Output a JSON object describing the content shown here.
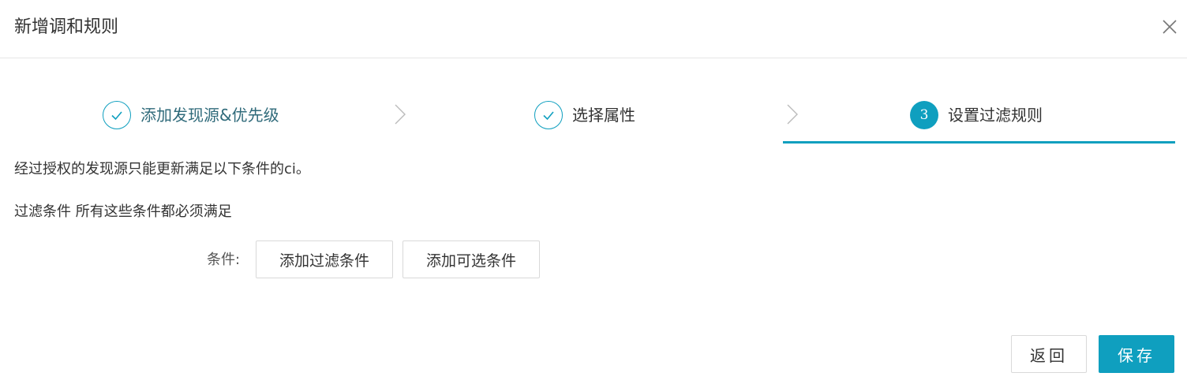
{
  "dialog": {
    "title": "新增调和规则"
  },
  "steps": [
    {
      "label": "添加发现源&优先级",
      "status": "done",
      "icon": "check-icon"
    },
    {
      "label": "选择属性",
      "status": "done",
      "icon": "check-icon"
    },
    {
      "label": "设置过滤规则",
      "status": "active",
      "number": "3"
    }
  ],
  "content": {
    "description": "经过授权的发现源只能更新满足以下条件的ci。",
    "filter_condition_text": "过滤条件 所有这些条件都必须满足",
    "condition_label": "条件:",
    "add_filter_label": "添加过滤条件",
    "add_optional_label": "添加可选条件"
  },
  "footer": {
    "back_label": "返回",
    "save_label": "保存"
  },
  "colors": {
    "accent": "#0f9fbf",
    "border": "#d9d9d9",
    "text": "#333333"
  }
}
